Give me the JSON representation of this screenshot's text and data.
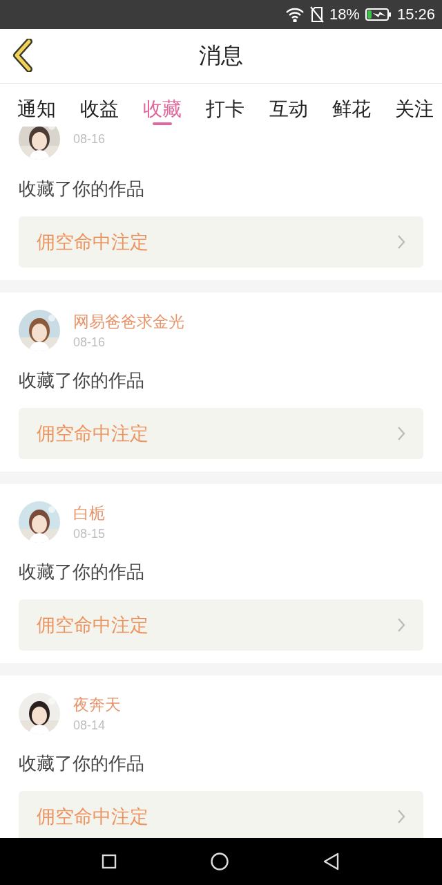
{
  "status_bar": {
    "battery": "18%",
    "time": "15:26"
  },
  "header": {
    "title": "消息"
  },
  "tabs": [
    {
      "label": "通知",
      "selected": false
    },
    {
      "label": "收益",
      "selected": false
    },
    {
      "label": "收藏",
      "selected": true
    },
    {
      "label": "打卡",
      "selected": false
    },
    {
      "label": "互动",
      "selected": false
    },
    {
      "label": "鲜花",
      "selected": false
    },
    {
      "label": "关注",
      "selected": false
    }
  ],
  "messages": [
    {
      "date": "08-16",
      "action": "收藏了你的作品",
      "work": "佣空命中注定"
    },
    {
      "name": "网易爸爸求金光",
      "date": "08-16",
      "action": "收藏了你的作品",
      "work": "佣空命中注定"
    },
    {
      "name": "白栀",
      "date": "08-15",
      "action": "收藏了你的作品",
      "work": "佣空命中注定"
    },
    {
      "name": "夜奔天",
      "date": "08-14",
      "action": "收藏了你的作品",
      "work": "佣空命中注定"
    }
  ]
}
